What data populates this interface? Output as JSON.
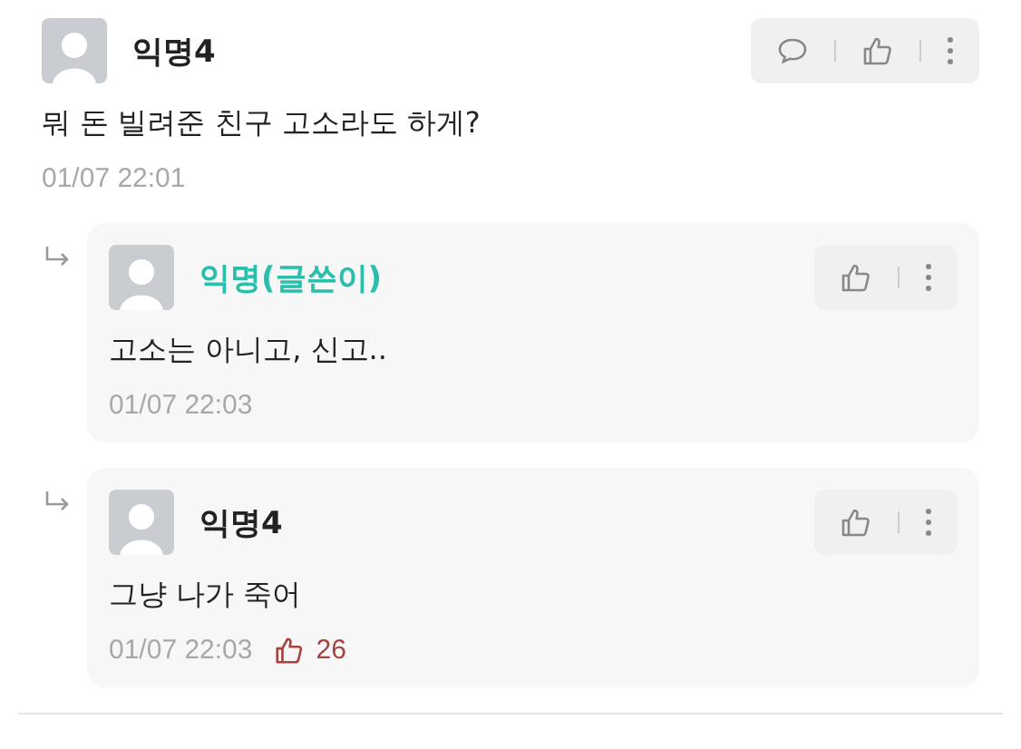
{
  "comments": [
    {
      "kind": "comment",
      "author": "익명4",
      "is_writer": false,
      "text": "뭐 돈 빌려준 친구 고소라도 하게?",
      "time": "01/07 22:01",
      "reply_button": true
    },
    {
      "kind": "reply",
      "author": "익명(글쓴이)",
      "is_writer": true,
      "text": "고소는 아니고, 신고..",
      "time": "01/07 22:03",
      "reply_button": false
    },
    {
      "kind": "reply",
      "author": "익명4",
      "is_writer": false,
      "text": "그냥 나가 죽어",
      "time": "01/07 22:03",
      "reply_button": false,
      "likes": "26"
    }
  ]
}
